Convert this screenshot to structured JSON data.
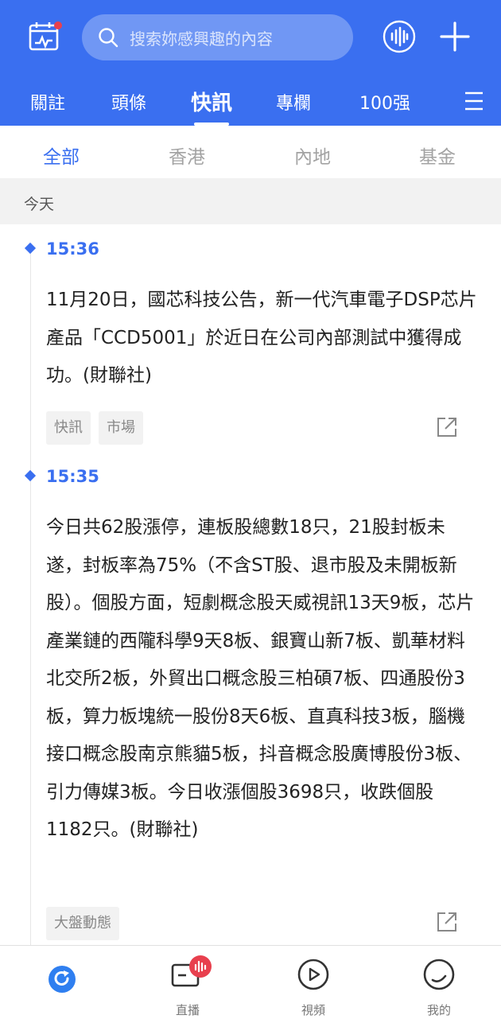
{
  "header": {
    "search_placeholder": "搜索妳感興趣的內容",
    "icons": [
      "calendar-chart-icon",
      "search-icon",
      "voice-icon",
      "plus-icon",
      "menu-icon"
    ],
    "tabs": [
      {
        "label": "關註"
      },
      {
        "label": "頭條"
      },
      {
        "label": "快訊",
        "active": true
      },
      {
        "label": "專欄"
      },
      {
        "label": "100强"
      }
    ]
  },
  "subtabs": [
    {
      "label": "全部",
      "active": true
    },
    {
      "label": "香港"
    },
    {
      "label": "內地"
    },
    {
      "label": "基金"
    }
  ],
  "day_label": "今天",
  "feed": [
    {
      "time": "15:36",
      "text": "11月20日，國芯科技公告，新一代汽車電子DSP芯片產品「CCD5001」於近日在公司內部測試中獲得成功。(財聯社)",
      "tags": [
        "快訊",
        "市場"
      ]
    },
    {
      "time": "15:35",
      "text": "今日共62股漲停，連板股總數18只，21股封板未遂，封板率為75%（不含ST股、退市股及未開板新股）。個股方面，短劇概念股天威視訊13天9板，芯片產業鏈的西隴科學9天8板、銀寶山新7板、凱華材料北交所2板，外貿出口概念股三柏碩7板、四通股份3板，算力板塊統一股份8天6板、直真科技3板，腦機接口概念股南京熊貓5板，抖音概念股廣博股份3板、引力傳媒3板。今日收漲個股3698只，收跌個股1182只。(財聯社)",
      "tags": [
        "大盤動態"
      ]
    }
  ],
  "bottom_nav": [
    {
      "label": "",
      "icon": "refresh-icon"
    },
    {
      "label": "直播",
      "icon": "live-icon"
    },
    {
      "label": "視頻",
      "icon": "video-play-icon"
    },
    {
      "label": "我的",
      "icon": "profile-icon"
    }
  ],
  "colors": {
    "brand": "#3a6ff0",
    "badge": "#e8404e"
  }
}
